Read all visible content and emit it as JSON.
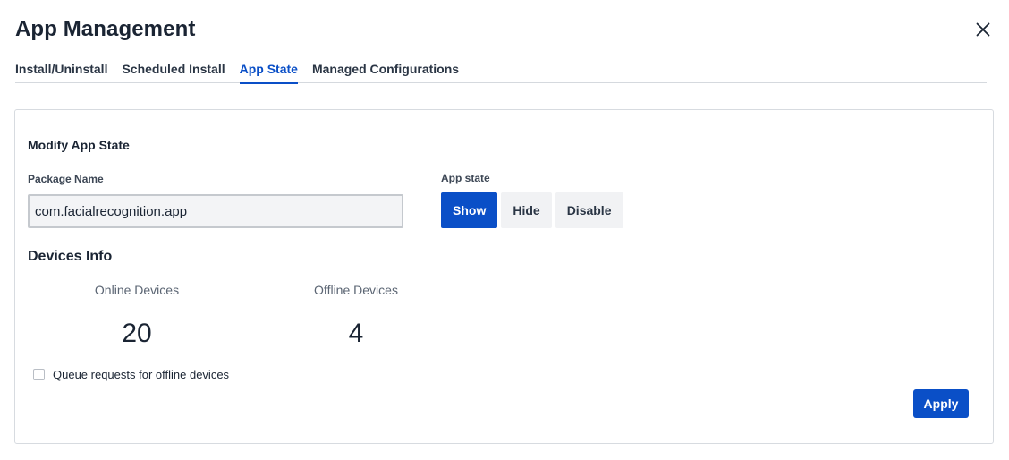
{
  "dialog": {
    "title": "App Management"
  },
  "tabs": [
    {
      "label": "Install/Uninstall",
      "active": false
    },
    {
      "label": "Scheduled Install",
      "active": false
    },
    {
      "label": "App State",
      "active": true
    },
    {
      "label": "Managed Configurations",
      "active": false
    }
  ],
  "modify": {
    "section_title": "Modify App State",
    "package_label": "Package Name",
    "package_value": "com.facialrecognition.app",
    "state_label": "App state",
    "state_options": [
      "Show",
      "Hide",
      "Disable"
    ],
    "selected_state": "Show"
  },
  "devices": {
    "title": "Devices Info",
    "online_label": "Online Devices",
    "online_count": "20",
    "offline_label": "Offline Devices",
    "offline_count": "4"
  },
  "queue": {
    "label": "Queue requests for offline devices",
    "checked": false
  },
  "actions": {
    "apply_label": "Apply"
  },
  "colors": {
    "accent": "#0a4fc7",
    "text": "#1a2433",
    "border": "#d7dbe0"
  },
  "icons": {
    "close": "close-icon"
  }
}
